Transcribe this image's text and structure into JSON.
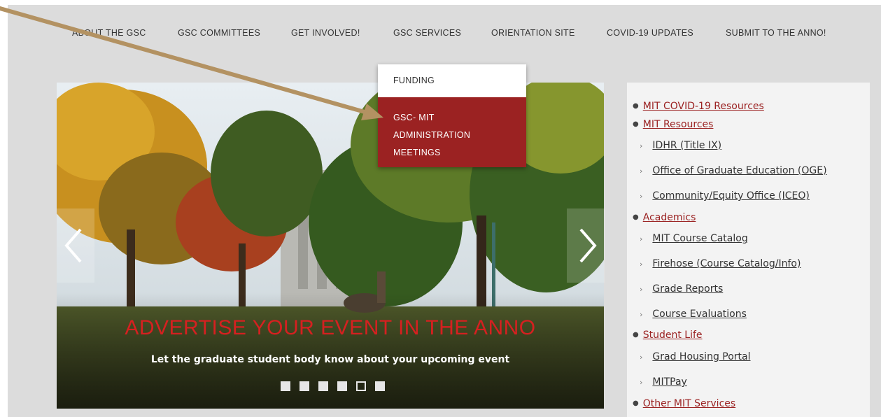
{
  "nav": {
    "items": [
      "ABOUT THE GSC",
      "GSC COMMITTEES",
      "GET INVOLVED!",
      "GSC SERVICES",
      "ORIENTATION SITE",
      "COVID-19 UPDATES",
      "SUBMIT TO THE ANNO!"
    ]
  },
  "dropdown": {
    "item1": "FUNDING",
    "item2_line1": "GSC- MIT",
    "item2_line2": "ADMINISTRATION",
    "item2_line3": "MEETINGS"
  },
  "carousel": {
    "title": "ADVERTISE YOUR EVENT IN THE ANNO",
    "subtitle": "Let the graduate student body know about your upcoming event",
    "dot_count": 6,
    "active_dot_index": 4
  },
  "sidebar": {
    "covid": "MIT COVID-19 Resources",
    "resources": "MIT Resources",
    "idhr": "IDHR (Title IX)",
    "oge": "Office of Graduate Education (OGE)",
    "iceo": "Community/Equity Office (ICEO)",
    "academics": "Academics",
    "catalog": "MIT Course Catalog",
    "firehose": "Firehose (Course Catalog/Info)",
    "grades": "Grade Reports",
    "evals": "Course Evaluations",
    "student_life": "Student Life",
    "housing": "Grad Housing Portal",
    "mitpay": "MITPay",
    "other": "Other MIT Services"
  },
  "colors": {
    "accent": "#9b2222",
    "annotation_arrow": "#b39262"
  }
}
